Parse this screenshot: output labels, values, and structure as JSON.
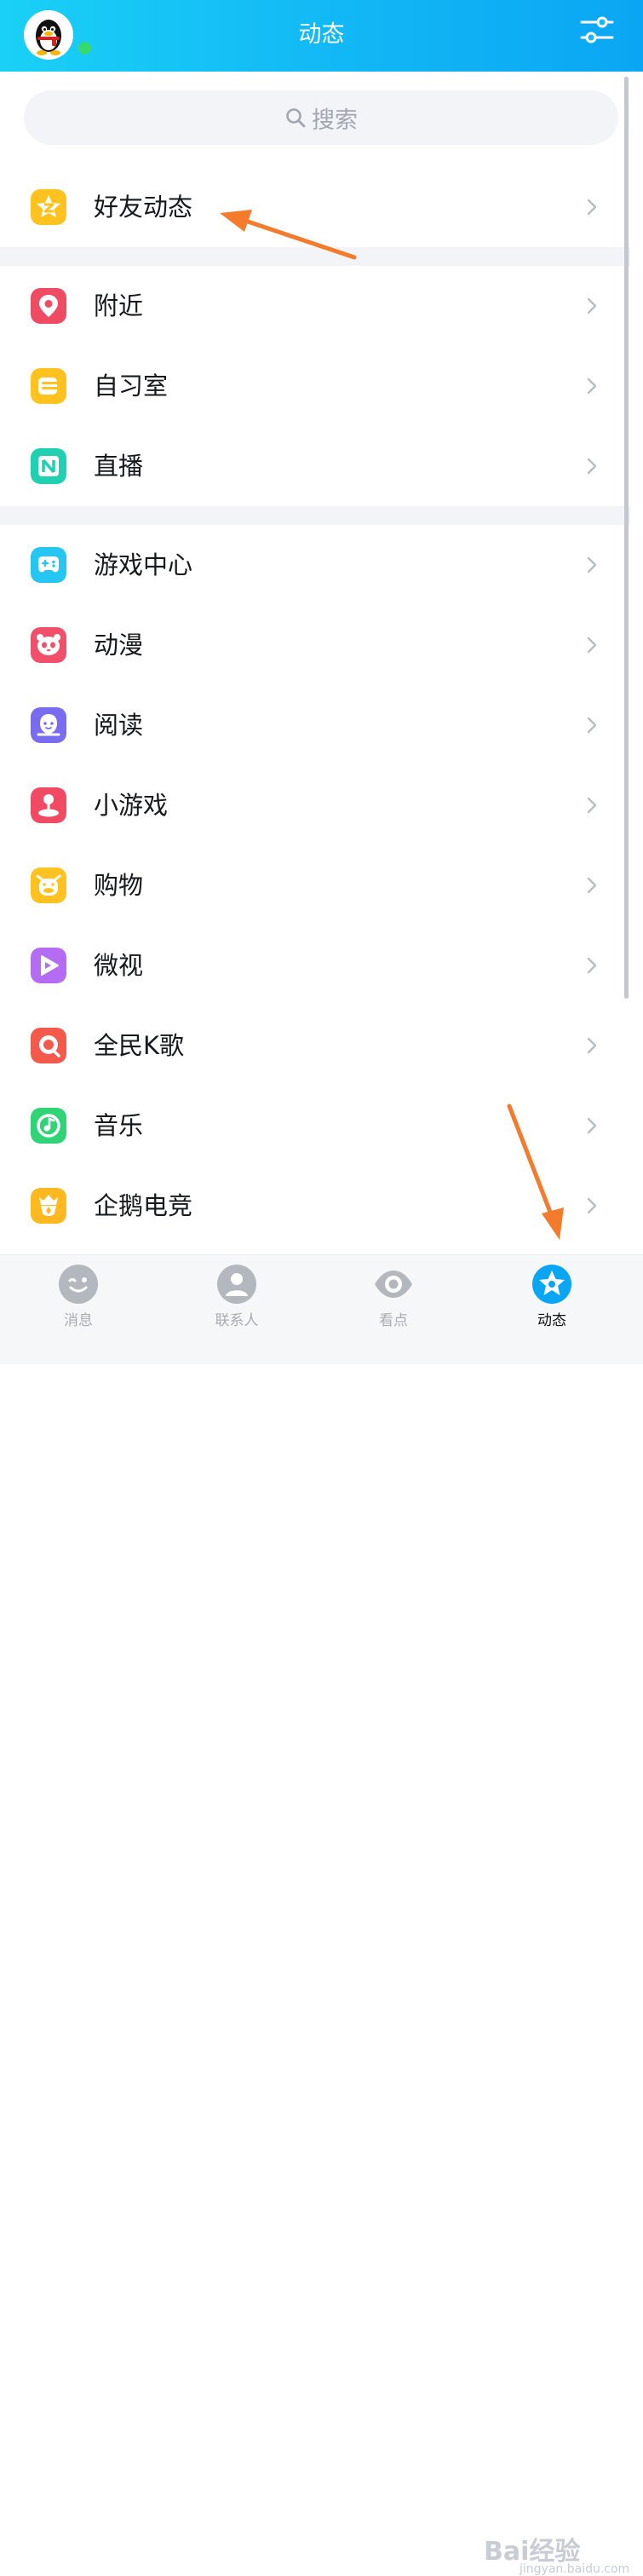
{
  "header": {
    "title": "动态"
  },
  "search": {
    "placeholder": "搜索"
  },
  "groups": [
    {
      "items": [
        {
          "label": "好友动态",
          "icon": "friend-feed-icon",
          "color": "#ffc21f"
        }
      ]
    },
    {
      "items": [
        {
          "label": "附近",
          "icon": "location-pin-icon",
          "color": "#ef4b62"
        },
        {
          "label": "自习室",
          "icon": "study-room-icon",
          "color": "#ffc21f"
        },
        {
          "label": "直播",
          "icon": "live-icon",
          "color": "#1fd1b0"
        }
      ]
    },
    {
      "items": [
        {
          "label": "游戏中心",
          "icon": "gamepad-icon",
          "color": "#25c7f2"
        },
        {
          "label": "动漫",
          "icon": "panda-icon",
          "color": "#f2506a"
        },
        {
          "label": "阅读",
          "icon": "book-reader-icon",
          "color": "#7a6cf0"
        },
        {
          "label": "小游戏",
          "icon": "joystick-icon",
          "color": "#f24a63"
        },
        {
          "label": "购物",
          "icon": "shopping-cow-icon",
          "color": "#ffc21f"
        },
        {
          "label": "微视",
          "icon": "play-icon",
          "color": "#b46cf2"
        },
        {
          "label": "全民K歌",
          "icon": "karaoke-icon",
          "color": "#f45a4c"
        },
        {
          "label": "音乐",
          "icon": "music-icon",
          "color": "#2fd477"
        },
        {
          "label": "企鹅电竞",
          "icon": "esports-icon",
          "color": "#ffb81f"
        }
      ]
    }
  ],
  "tabs": [
    {
      "label": "消息",
      "icon": "message-icon",
      "active": false
    },
    {
      "label": "联系人",
      "icon": "contacts-icon",
      "active": false
    },
    {
      "label": "看点",
      "icon": "eye-icon",
      "active": false
    },
    {
      "label": "动态",
      "icon": "star-feed-icon",
      "active": true
    }
  ],
  "watermark": {
    "brand": "Bai经验",
    "url": "jingyan.baidu.com"
  },
  "colors": {
    "header_start": "#1ad0f6",
    "header_end": "#0ba6f3",
    "arrow": "#f47a2c",
    "tab_active": "#0ba6f3"
  }
}
